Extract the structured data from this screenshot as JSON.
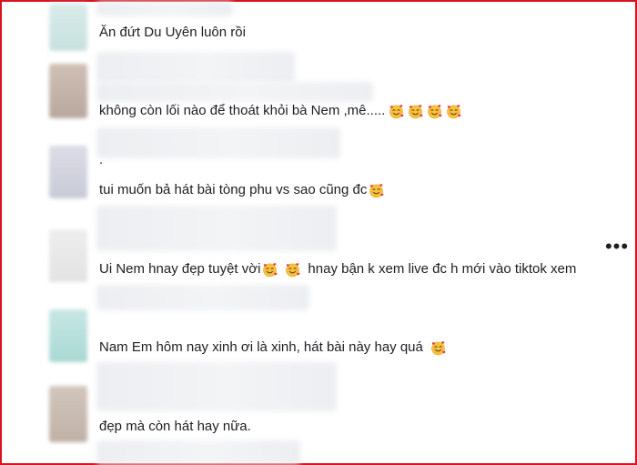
{
  "comments": [
    {
      "text_before": "Ăn đứt Du Uyên luôn rồi",
      "emojis": [],
      "text_after": ""
    },
    {
      "text_before": "không còn lối nào để thoát khỏi bà Nem ,mê.....",
      "emojis": [
        "smiling-face-with-hearts",
        "smiling-face-with-hearts",
        "smiling-face-with-hearts",
        "smiling-face-with-hearts"
      ],
      "text_after": ""
    },
    {
      "text_before": ".",
      "emojis": [],
      "text_after": ""
    },
    {
      "text_before": "tui muốn bả hát bài tòng phu vs sao cũng đc",
      "emojis": [
        "smiling-face-with-hearts"
      ],
      "text_after": ""
    },
    {
      "text_before": "Ui Nem hnay đẹp tuyệt vời",
      "emojis": [
        "smiling-face-with-hearts",
        "smiling-face-with-hearts"
      ],
      "text_after": "hnay bận k xem live đc h mới vào tiktok xem"
    },
    {
      "text_before": "Nam Em hôm nay xinh ơi là xinh, hát bài này hay quá",
      "emojis": [
        "smiling-face-with-hearts"
      ],
      "text_after": ""
    },
    {
      "text_before": "đẹp mà còn hát hay nữa.",
      "emojis": [],
      "text_after": ""
    }
  ],
  "more_button": {
    "label": "•••",
    "icon": "more-options-icon"
  },
  "colors": {
    "border": "#d8131f",
    "text": "#1c1e21"
  }
}
